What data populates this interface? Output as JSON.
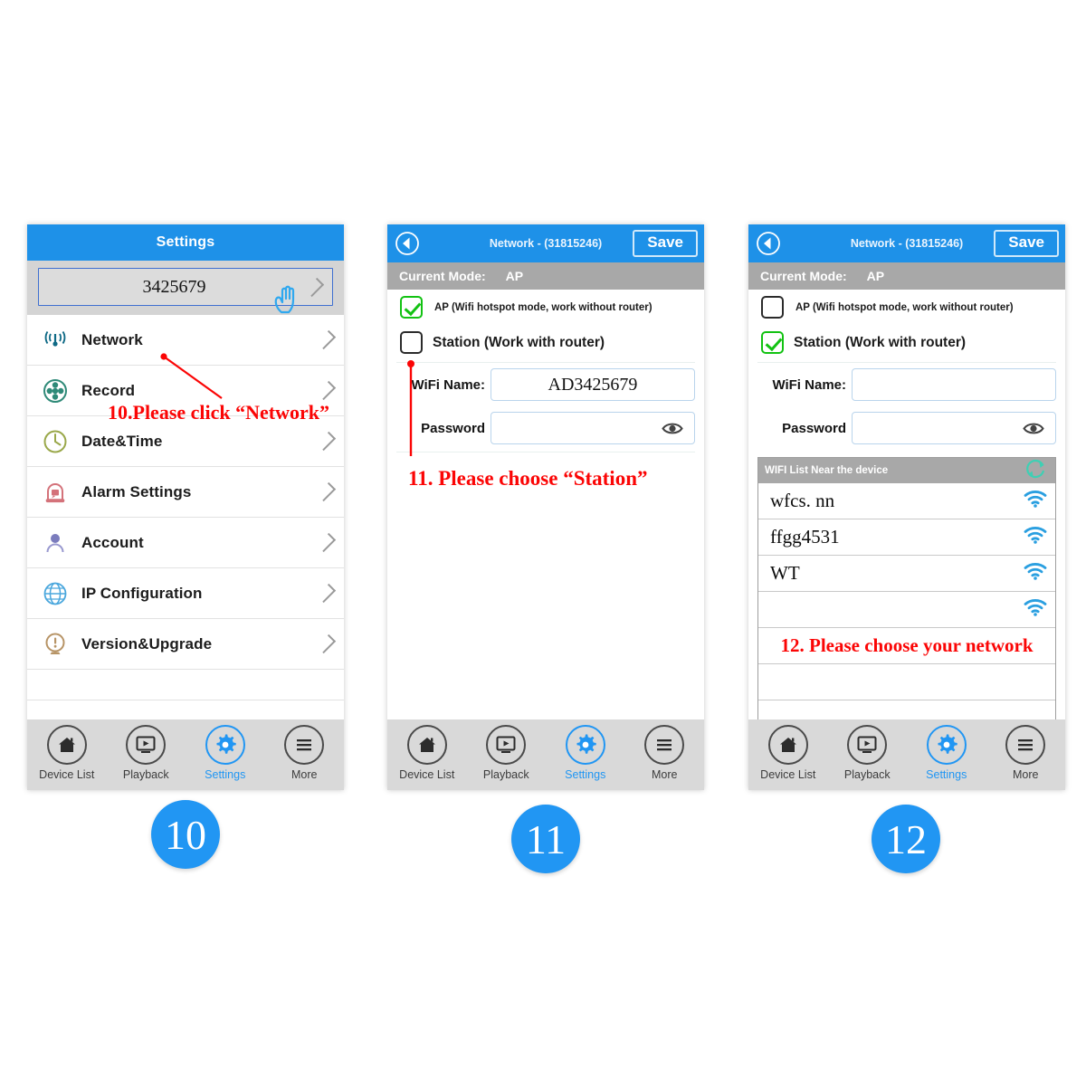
{
  "panels": [
    {
      "step": "10",
      "title": "Settings",
      "device_id": "3425679",
      "settings_items": [
        {
          "label": "Network",
          "icon": "wifi-signal-icon"
        },
        {
          "label": "Record",
          "icon": "record-reel-icon"
        },
        {
          "label": "Date&Time",
          "icon": "clock-icon"
        },
        {
          "label": "Alarm Settings",
          "icon": "alarm-bell-icon"
        },
        {
          "label": "Account",
          "icon": "user-icon"
        },
        {
          "label": "IP Configuration",
          "icon": "globe-icon"
        },
        {
          "label": "Version&Upgrade",
          "icon": "exclamation-icon"
        }
      ],
      "annotation": "10.Please click “Network”"
    },
    {
      "step": "11",
      "title": "Network  - (31815246)",
      "save_label": "Save",
      "mode_label": "Current Mode:",
      "mode_value": "AP",
      "ap_label": "AP (Wifi hotspot mode, work without router)",
      "ap_checked": true,
      "station_label": "Station (Work with router)",
      "station_checked": false,
      "wifi_name_label": "WiFi Name:",
      "wifi_name_value": "AD3425679",
      "password_label": "Password",
      "password_value": "",
      "annotation": "11. Please choose “Station”"
    },
    {
      "step": "12",
      "title": "Network  - (31815246)",
      "save_label": "Save",
      "mode_label": "Current Mode:",
      "mode_value": "AP",
      "ap_label": "AP (Wifi hotspot mode, work without router)",
      "ap_checked": false,
      "station_label": "Station (Work with router)",
      "station_checked": true,
      "wifi_name_label": "WiFi Name:",
      "wifi_name_value": "",
      "password_label": "Password",
      "password_value": "",
      "wifi_list_header": "WIFI List Near the device",
      "wifi_networks": [
        "wfcs. nn",
        "ffgg4531",
        "WT",
        ""
      ],
      "annotation": "12. Please choose your network"
    }
  ],
  "tabbar": {
    "items": [
      {
        "label": "Device List",
        "icon": "home-icon",
        "active": false
      },
      {
        "label": "Playback",
        "icon": "monitor-play-icon",
        "active": false
      },
      {
        "label": "Settings",
        "icon": "gear-icon",
        "active": true
      },
      {
        "label": "More",
        "icon": "hamburger-icon",
        "active": false
      }
    ]
  },
  "colors": {
    "accent_blue": "#1e91e8",
    "tab_active": "#2196f3",
    "annotation_red": "#fb0505",
    "check_green": "#12c212",
    "mode_gray": "#a8a8a8",
    "refresh_teal": "#3ed0b4"
  }
}
